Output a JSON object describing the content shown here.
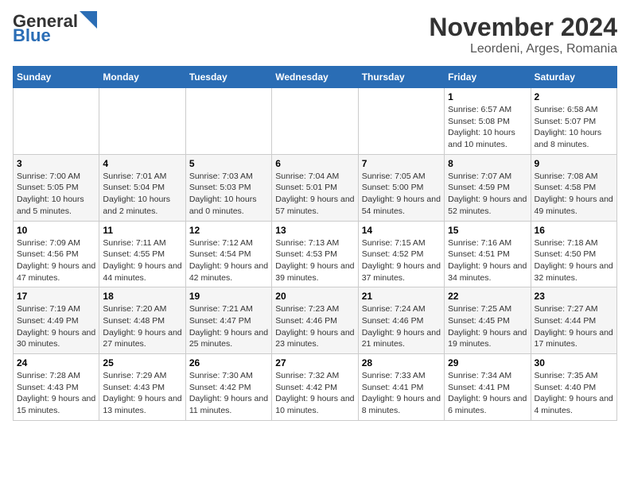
{
  "logo": {
    "part1": "General",
    "part2": "Blue"
  },
  "title": "November 2024",
  "subtitle": "Leordeni, Arges, Romania",
  "weekdays": [
    "Sunday",
    "Monday",
    "Tuesday",
    "Wednesday",
    "Thursday",
    "Friday",
    "Saturday"
  ],
  "weeks": [
    [
      {
        "day": "",
        "info": ""
      },
      {
        "day": "",
        "info": ""
      },
      {
        "day": "",
        "info": ""
      },
      {
        "day": "",
        "info": ""
      },
      {
        "day": "",
        "info": ""
      },
      {
        "day": "1",
        "info": "Sunrise: 6:57 AM\nSunset: 5:08 PM\nDaylight: 10 hours and 10 minutes."
      },
      {
        "day": "2",
        "info": "Sunrise: 6:58 AM\nSunset: 5:07 PM\nDaylight: 10 hours and 8 minutes."
      }
    ],
    [
      {
        "day": "3",
        "info": "Sunrise: 7:00 AM\nSunset: 5:05 PM\nDaylight: 10 hours and 5 minutes."
      },
      {
        "day": "4",
        "info": "Sunrise: 7:01 AM\nSunset: 5:04 PM\nDaylight: 10 hours and 2 minutes."
      },
      {
        "day": "5",
        "info": "Sunrise: 7:03 AM\nSunset: 5:03 PM\nDaylight: 10 hours and 0 minutes."
      },
      {
        "day": "6",
        "info": "Sunrise: 7:04 AM\nSunset: 5:01 PM\nDaylight: 9 hours and 57 minutes."
      },
      {
        "day": "7",
        "info": "Sunrise: 7:05 AM\nSunset: 5:00 PM\nDaylight: 9 hours and 54 minutes."
      },
      {
        "day": "8",
        "info": "Sunrise: 7:07 AM\nSunset: 4:59 PM\nDaylight: 9 hours and 52 minutes."
      },
      {
        "day": "9",
        "info": "Sunrise: 7:08 AM\nSunset: 4:58 PM\nDaylight: 9 hours and 49 minutes."
      }
    ],
    [
      {
        "day": "10",
        "info": "Sunrise: 7:09 AM\nSunset: 4:56 PM\nDaylight: 9 hours and 47 minutes."
      },
      {
        "day": "11",
        "info": "Sunrise: 7:11 AM\nSunset: 4:55 PM\nDaylight: 9 hours and 44 minutes."
      },
      {
        "day": "12",
        "info": "Sunrise: 7:12 AM\nSunset: 4:54 PM\nDaylight: 9 hours and 42 minutes."
      },
      {
        "day": "13",
        "info": "Sunrise: 7:13 AM\nSunset: 4:53 PM\nDaylight: 9 hours and 39 minutes."
      },
      {
        "day": "14",
        "info": "Sunrise: 7:15 AM\nSunset: 4:52 PM\nDaylight: 9 hours and 37 minutes."
      },
      {
        "day": "15",
        "info": "Sunrise: 7:16 AM\nSunset: 4:51 PM\nDaylight: 9 hours and 34 minutes."
      },
      {
        "day": "16",
        "info": "Sunrise: 7:18 AM\nSunset: 4:50 PM\nDaylight: 9 hours and 32 minutes."
      }
    ],
    [
      {
        "day": "17",
        "info": "Sunrise: 7:19 AM\nSunset: 4:49 PM\nDaylight: 9 hours and 30 minutes."
      },
      {
        "day": "18",
        "info": "Sunrise: 7:20 AM\nSunset: 4:48 PM\nDaylight: 9 hours and 27 minutes."
      },
      {
        "day": "19",
        "info": "Sunrise: 7:21 AM\nSunset: 4:47 PM\nDaylight: 9 hours and 25 minutes."
      },
      {
        "day": "20",
        "info": "Sunrise: 7:23 AM\nSunset: 4:46 PM\nDaylight: 9 hours and 23 minutes."
      },
      {
        "day": "21",
        "info": "Sunrise: 7:24 AM\nSunset: 4:46 PM\nDaylight: 9 hours and 21 minutes."
      },
      {
        "day": "22",
        "info": "Sunrise: 7:25 AM\nSunset: 4:45 PM\nDaylight: 9 hours and 19 minutes."
      },
      {
        "day": "23",
        "info": "Sunrise: 7:27 AM\nSunset: 4:44 PM\nDaylight: 9 hours and 17 minutes."
      }
    ],
    [
      {
        "day": "24",
        "info": "Sunrise: 7:28 AM\nSunset: 4:43 PM\nDaylight: 9 hours and 15 minutes."
      },
      {
        "day": "25",
        "info": "Sunrise: 7:29 AM\nSunset: 4:43 PM\nDaylight: 9 hours and 13 minutes."
      },
      {
        "day": "26",
        "info": "Sunrise: 7:30 AM\nSunset: 4:42 PM\nDaylight: 9 hours and 11 minutes."
      },
      {
        "day": "27",
        "info": "Sunrise: 7:32 AM\nSunset: 4:42 PM\nDaylight: 9 hours and 10 minutes."
      },
      {
        "day": "28",
        "info": "Sunrise: 7:33 AM\nSunset: 4:41 PM\nDaylight: 9 hours and 8 minutes."
      },
      {
        "day": "29",
        "info": "Sunrise: 7:34 AM\nSunset: 4:41 PM\nDaylight: 9 hours and 6 minutes."
      },
      {
        "day": "30",
        "info": "Sunrise: 7:35 AM\nSunset: 4:40 PM\nDaylight: 9 hours and 4 minutes."
      }
    ]
  ]
}
